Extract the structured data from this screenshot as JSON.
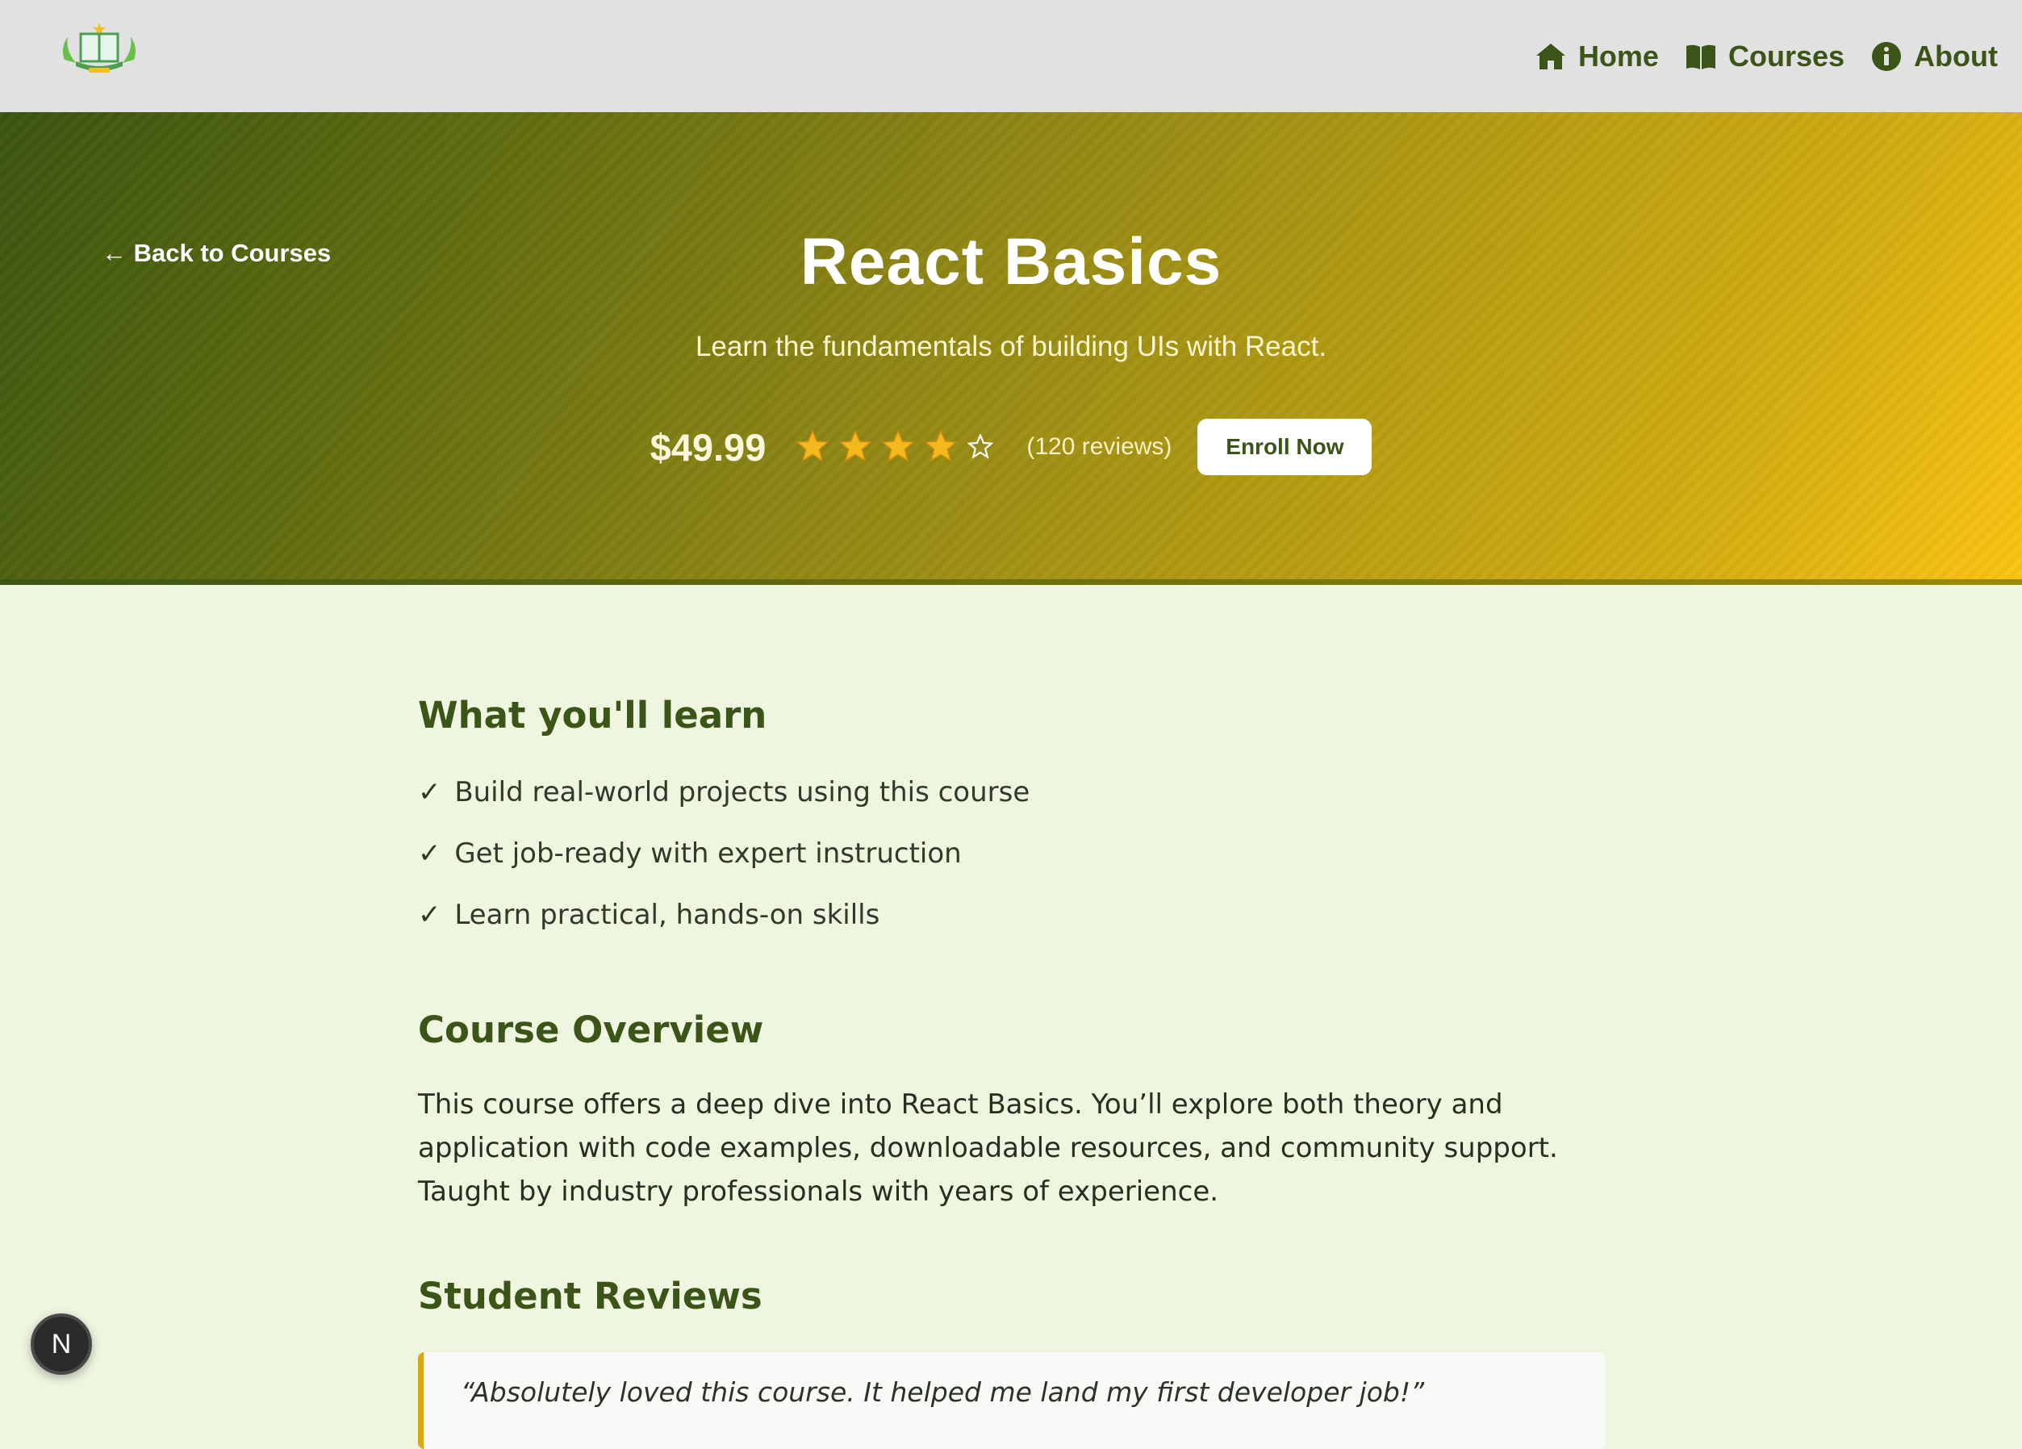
{
  "nav": {
    "logo_icon": "graduation-book-logo",
    "items": [
      {
        "label": "Home",
        "icon": "home-icon"
      },
      {
        "label": "Courses",
        "icon": "book-icon"
      },
      {
        "label": "About",
        "icon": "info-icon"
      }
    ]
  },
  "hero": {
    "back_link": "← Back to Courses",
    "title": "React Basics",
    "subtitle": "Learn the fundamentals of building UIs with React.",
    "price": "$49.99",
    "rating": 4,
    "rating_max": 5,
    "reviews_count": "(120 reviews)",
    "enroll_label": "Enroll Now"
  },
  "learn": {
    "heading": "What you'll learn",
    "check_symbol": "✓",
    "items": [
      "Build real-world projects using this course",
      "Get job-ready with expert instruction",
      "Learn practical, hands-on skills"
    ]
  },
  "overview": {
    "heading": "Course Overview",
    "text": "This course offers a deep dive into React Basics. You’ll explore both theory and application with code examples, downloadable resources, and community support. Taught by industry professionals with years of experience."
  },
  "reviews": {
    "heading": "Student Reviews",
    "items": [
      {
        "text": "“Absolutely loved this course. It helped me land my first developer job!”"
      }
    ]
  },
  "badge": {
    "label": "N"
  },
  "colors": {
    "brand_green": "#3b5417",
    "nav_bg": "#e1e1e1",
    "page_bg": "#eff6e0",
    "hero_start": "#3b5510",
    "hero_end": "#fcc412",
    "review_accent": "#d8a714",
    "star_fill": "#f3b81c"
  }
}
